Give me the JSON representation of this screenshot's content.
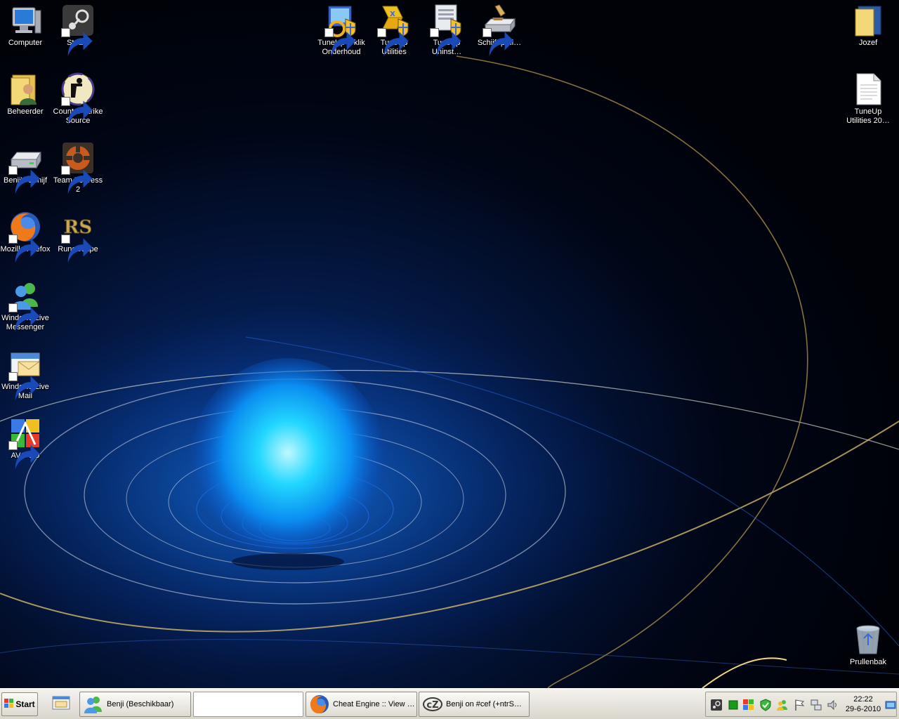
{
  "desktop": {
    "icons": [
      {
        "name": "computer",
        "label": "Computer",
        "icon": "computer-icon"
      },
      {
        "name": "steam",
        "label": "Steam",
        "icon": "steam-icon"
      },
      {
        "name": "beheerder",
        "label": "Beheerder",
        "icon": "user-folder-icon"
      },
      {
        "name": "counter-strike-source",
        "label": "Counter-Strike\nSource",
        "icon": "counter-strike-icon"
      },
      {
        "name": "benjis-schijf",
        "label": "Benji's Schijf",
        "icon": "drive-icon"
      },
      {
        "name": "team-fortress-2",
        "label": "Team Fortress\n2",
        "icon": "team-fortress-icon"
      },
      {
        "name": "mozilla-firefox",
        "label": "Mozilla Firefox",
        "icon": "firefox-icon"
      },
      {
        "name": "runescape",
        "label": "RuneScape",
        "icon": "runescape-icon"
      },
      {
        "name": "windows-live-messenger",
        "label": "Windows Live\nMessenger",
        "icon": "messenger-icon"
      },
      {
        "name": "windows-live-mail",
        "label": "Windows Live\nMail",
        "icon": "mail-icon"
      },
      {
        "name": "avg",
        "label": "AVG 9.0",
        "icon": "avg-icon"
      },
      {
        "name": "tuneup-1-klik-onderhoud",
        "label": "TuneUp 1-klik\nOnderhoud",
        "icon": "tuneup-maintenance-icon"
      },
      {
        "name": "tuneup-utilities",
        "label": "TuneUp\nUtilities",
        "icon": "tuneup-icon"
      },
      {
        "name": "tuneup-uninstall",
        "label": "TuneUp\nUninst…",
        "icon": "tuneup-uninstall-icon"
      },
      {
        "name": "schijfopruiming",
        "label": "Schijfoprui…",
        "icon": "disk-cleanup-icon"
      },
      {
        "name": "jozef",
        "label": "Jozef",
        "icon": "folder-icon"
      },
      {
        "name": "tuneup-utilities-file",
        "label": "TuneUp\nUtilities 20…",
        "icon": "document-icon"
      },
      {
        "name": "prullenbak",
        "label": "Prullenbak",
        "icon": "recycle-bin-icon"
      }
    ]
  },
  "taskbar": {
    "start_label": "Start",
    "tasks": [
      {
        "name": "messenger",
        "label": "Benji (Beschikbaar)",
        "icon": "messenger-icon"
      },
      {
        "name": "blank",
        "label": "",
        "icon": ""
      },
      {
        "name": "firefox-cheat-engine",
        "label": "Cheat Engine :: View …",
        "icon": "firefox-icon"
      },
      {
        "name": "irc",
        "label": "Benji on #cef (+ntrS…",
        "icon": "irc-icon"
      }
    ],
    "tray": {
      "icons": [
        "steam-icon",
        "green-square-icon",
        "windows-icon",
        "shield-check-icon",
        "messenger-icon",
        "flag-icon",
        "network-icon",
        "speaker-icon"
      ],
      "time": "22:22",
      "date": "29-6-2010"
    }
  }
}
